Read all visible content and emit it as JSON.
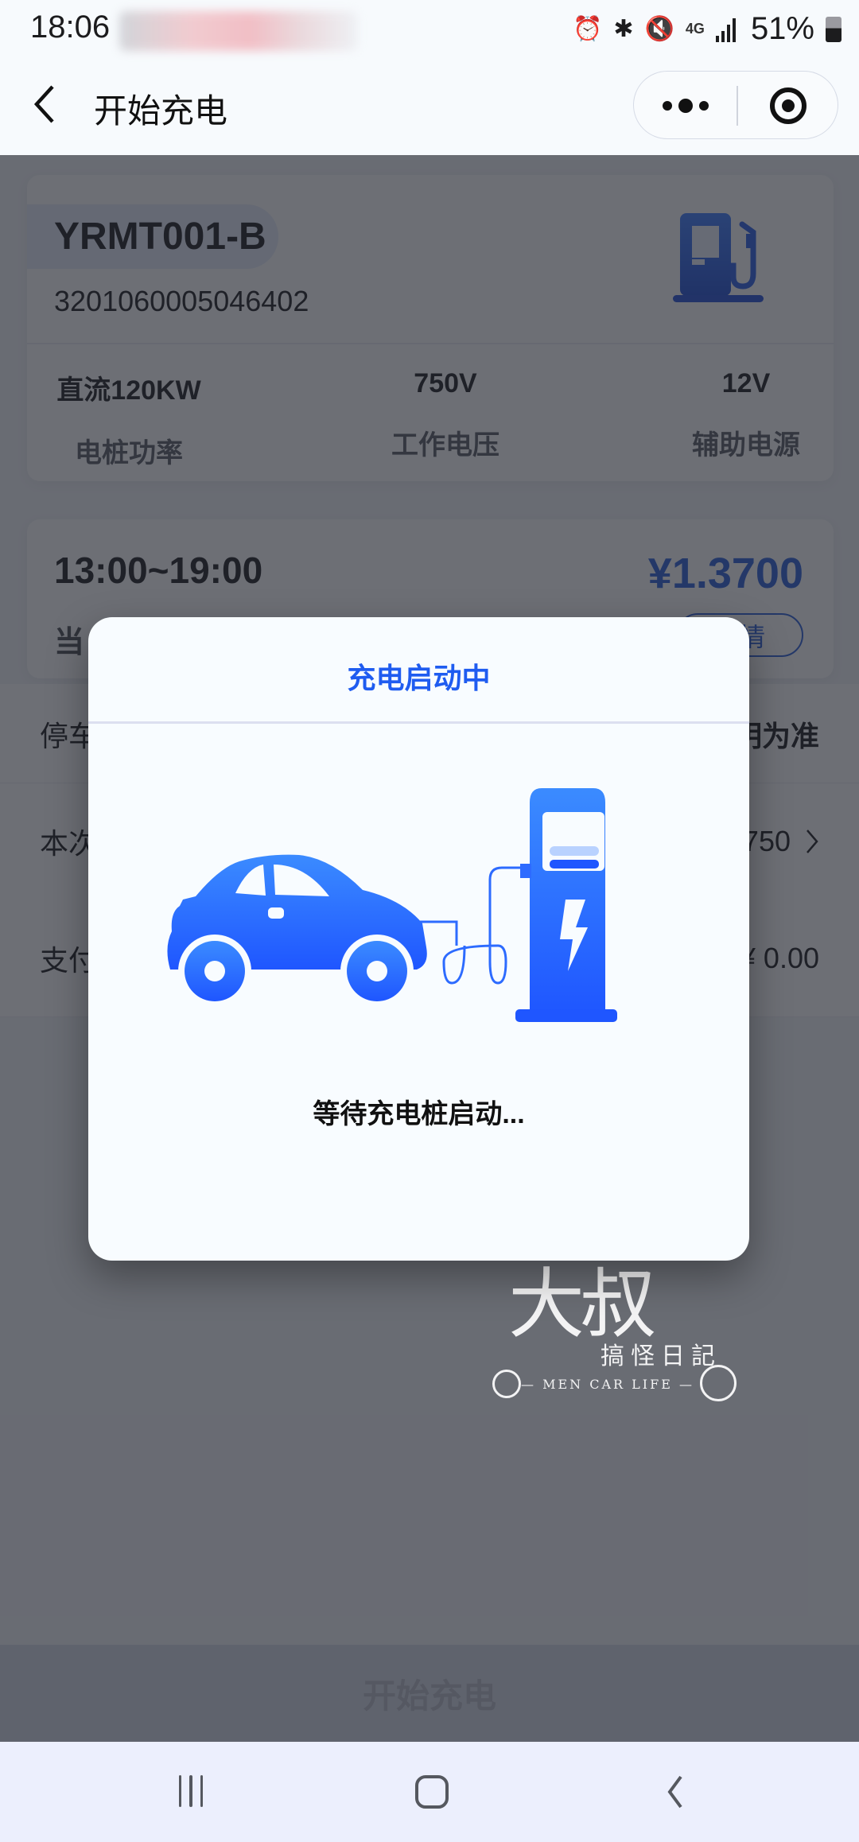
{
  "status_bar": {
    "time": "18:06",
    "network": "4G",
    "battery_percent": "51%",
    "icons": [
      "alarm-icon",
      "bluetooth-icon",
      "mute-icon",
      "4g-data-icon",
      "signal-icon",
      "battery-icon"
    ]
  },
  "header": {
    "title": "开始充电",
    "back_icon": "chevron-left-icon",
    "more_icon": "more-dots-icon",
    "close_icon": "target-circle-icon"
  },
  "pile": {
    "code": "YRMT001-B",
    "serial": "3201060005046402",
    "icon": "fuel-pump-icon",
    "stats": [
      {
        "value": "直流120KW",
        "label": "电桩功率"
      },
      {
        "value": "750V",
        "label": "工作电压"
      },
      {
        "value": "12V",
        "label": "辅助电源"
      }
    ]
  },
  "pricing": {
    "period": "13:00~19:00",
    "price": "¥1.3700",
    "current_label_partial": "当",
    "details_label_partial": "详情"
  },
  "rows": [
    {
      "label_partial": "停车",
      "value_partial": "明为准"
    },
    {
      "label_partial": "本次",
      "value_partial": "750"
    },
    {
      "label_partial": "支付",
      "value_partial": "¥ 0.00"
    }
  ],
  "bottom_button": {
    "label": "开始充电"
  },
  "modal": {
    "title": "充电启动中",
    "illustration": "car-charging-illustration",
    "message": "等待充电桩启动...",
    "accent_color": "#1f5cf0"
  },
  "watermark": {
    "big": "大叔",
    "small": "搞怪日記",
    "line": "— MEN  CAR  LIFE —"
  },
  "system_nav": {
    "recents_icon": "recents-icon",
    "home_icon": "home-icon",
    "back_icon": "back-icon"
  }
}
